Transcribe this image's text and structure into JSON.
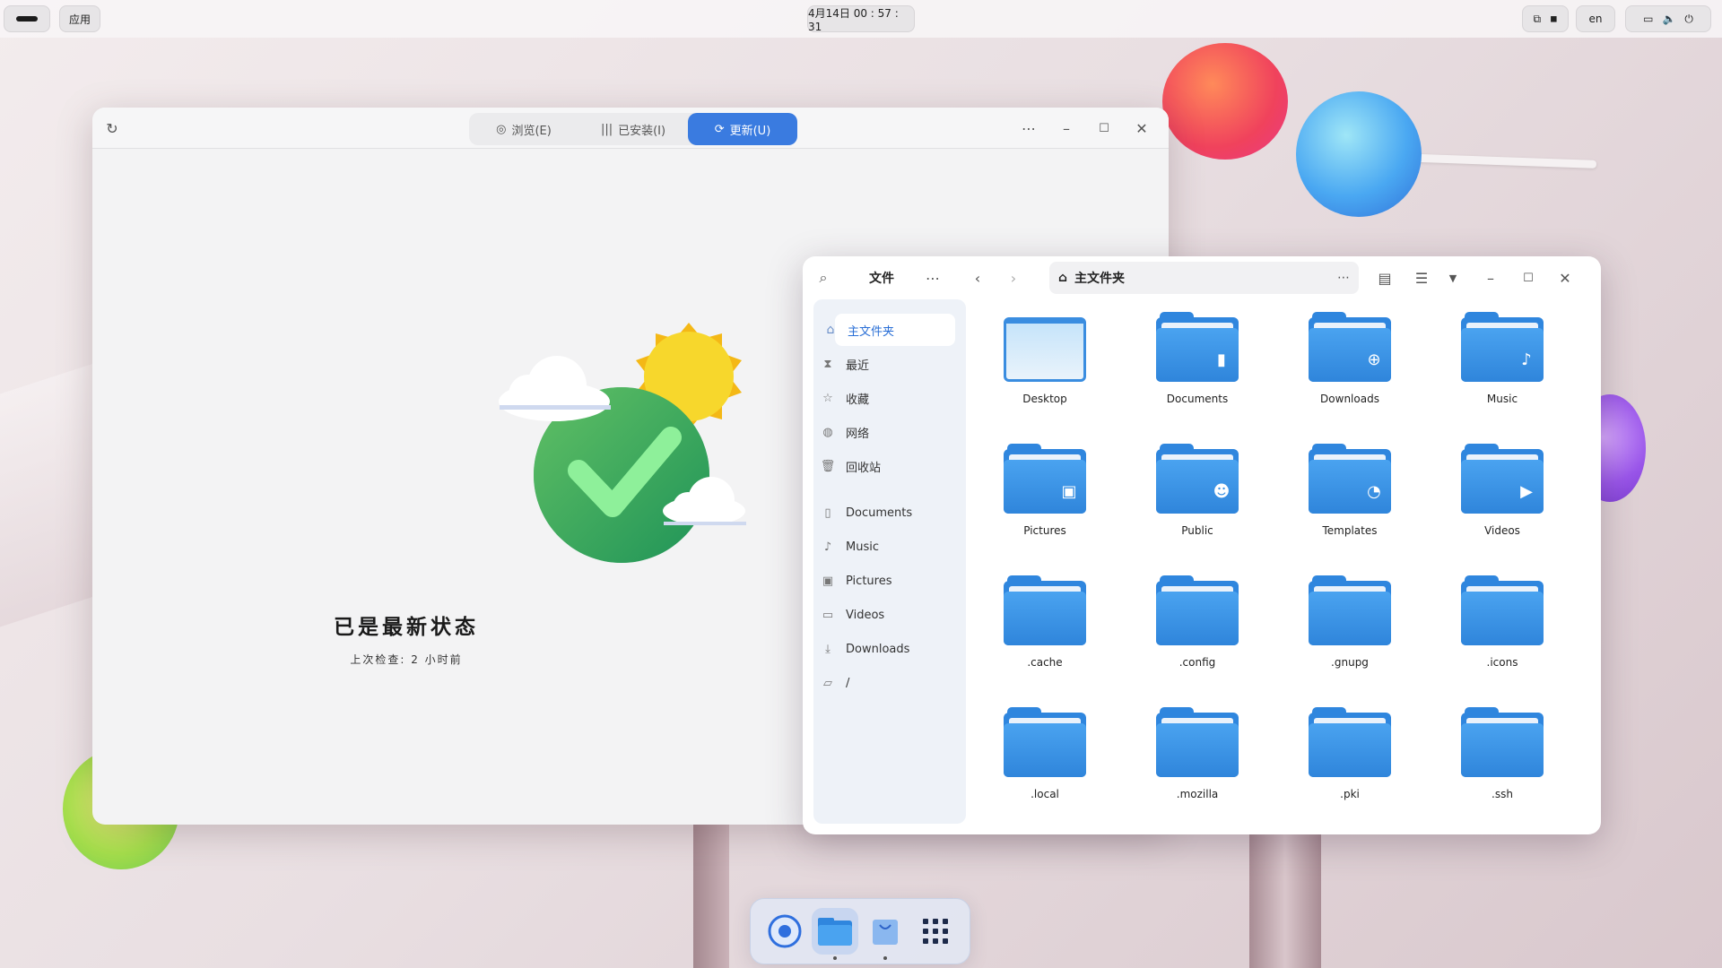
{
  "topbar": {
    "apps_label": "应用",
    "datetime": "4月14日  00 : 57 : 31",
    "lang": "en"
  },
  "store": {
    "tabs": [
      {
        "label": "浏览(E)",
        "icon": "compass-icon"
      },
      {
        "label": "已安装(I)",
        "icon": "library-icon"
      },
      {
        "label": "更新(U)",
        "icon": "refresh-icon"
      }
    ],
    "status_title": "已是最新状态",
    "status_sub": "上次检查: 2 小时前"
  },
  "filemanager": {
    "title": "文件",
    "location": "主文件夹",
    "sidebar": [
      {
        "label": "主文件夹",
        "icon": "home-icon"
      },
      {
        "label": "最近",
        "icon": "hourglass-icon"
      },
      {
        "label": "收藏",
        "icon": "star-icon"
      },
      {
        "label": "网络",
        "icon": "network-icon"
      },
      {
        "label": "回收站",
        "icon": "trash-icon"
      },
      {
        "label": "Documents",
        "icon": "document-icon"
      },
      {
        "label": "Music",
        "icon": "music-note-icon"
      },
      {
        "label": "Pictures",
        "icon": "picture-icon"
      },
      {
        "label": "Videos",
        "icon": "video-icon"
      },
      {
        "label": "Downloads",
        "icon": "download-icon"
      },
      {
        "label": "/",
        "icon": "folder-icon"
      }
    ],
    "items": [
      {
        "label": "Desktop",
        "emblem": ""
      },
      {
        "label": "Documents",
        "emblem": "document"
      },
      {
        "label": "Downloads",
        "emblem": "download"
      },
      {
        "label": "Music",
        "emblem": "music"
      },
      {
        "label": "Pictures",
        "emblem": "picture"
      },
      {
        "label": "Public",
        "emblem": "people"
      },
      {
        "label": "Templates",
        "emblem": "template"
      },
      {
        "label": "Videos",
        "emblem": "video"
      },
      {
        "label": ".cache",
        "emblem": ""
      },
      {
        "label": ".config",
        "emblem": ""
      },
      {
        "label": ".gnupg",
        "emblem": ""
      },
      {
        "label": ".icons",
        "emblem": ""
      },
      {
        "label": ".local",
        "emblem": ""
      },
      {
        "label": ".mozilla",
        "emblem": ""
      },
      {
        "label": ".pki",
        "emblem": ""
      },
      {
        "label": ".ssh",
        "emblem": ""
      }
    ]
  },
  "colors": {
    "accent": "#3a7be0",
    "folder": "#2f86de"
  }
}
